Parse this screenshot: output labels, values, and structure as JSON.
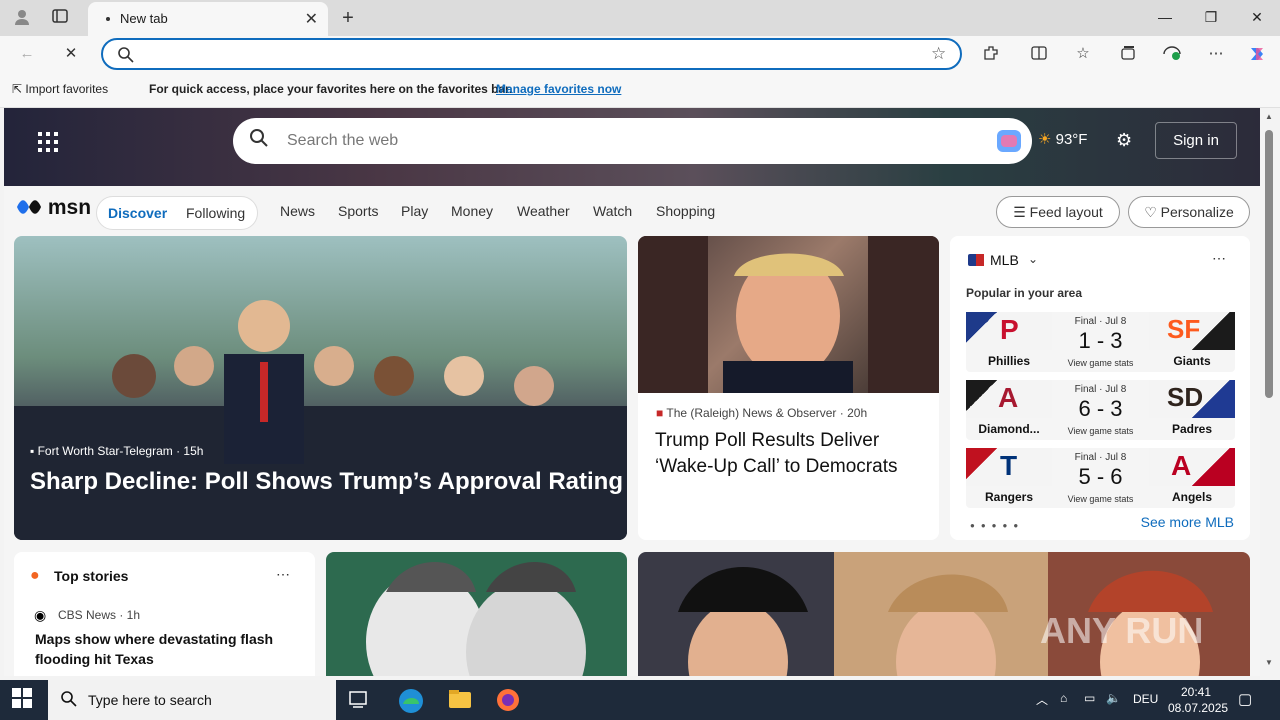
{
  "browser": {
    "tab_title": "New tab",
    "favorites_import": "Import favorites",
    "favorites_message": "For quick access, place your favorites here on the favorites bar.",
    "favorites_link": "Manage favorites now"
  },
  "msn": {
    "search_placeholder": "Search the web",
    "temperature": "93°F",
    "sign_in": "Sign in",
    "logo": "msn",
    "nav_primary": [
      "Discover",
      "Following"
    ],
    "nav_links": [
      "News",
      "Sports",
      "Play",
      "Money",
      "Weather",
      "Watch",
      "Shopping"
    ],
    "feed_layout": "Feed layout",
    "personalize": "Personalize"
  },
  "hero": {
    "source": "Fort Worth Star-Telegram",
    "age": "15h",
    "headline": "Sharp Decline: Poll Shows Trump’s Approval Rating"
  },
  "mid_card": {
    "source": "The (Raleigh) News & Observer",
    "age": "20h",
    "headline": "Trump Poll Results Deliver ‘Wake-Up Call’ to Democrats"
  },
  "mlb": {
    "title": "MLB",
    "subtitle": "Popular in your area",
    "games": [
      {
        "status": "Final · Jul 8",
        "score": "1 - 3",
        "home": "Phillies",
        "away": "Giants",
        "stats": "View game stats"
      },
      {
        "status": "Final · Jul 8",
        "score": "6 - 3",
        "home": "Diamond...",
        "away": "Padres",
        "stats": "View game stats"
      },
      {
        "status": "Final · Jul 8",
        "score": "5 - 6",
        "home": "Rangers",
        "away": "Angels",
        "stats": "View game stats"
      }
    ],
    "see_more": "See more MLB"
  },
  "top_stories": {
    "title": "Top stories",
    "source": "CBS News · 1h",
    "headline": "Maps show where devastating flash flooding hit Texas"
  },
  "taskbar": {
    "search_placeholder": "Type here to search",
    "time": "20:41",
    "date": "08.07.2025",
    "language": "DEU"
  },
  "watermark": "ANY RUN"
}
